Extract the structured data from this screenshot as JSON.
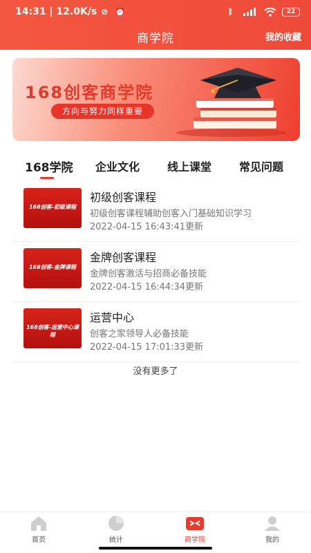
{
  "status_bar": {
    "time_speed": "14:31 | 12.0K/s",
    "battery": "22"
  },
  "header": {
    "title": "商学院",
    "favorites": "我的收藏"
  },
  "banner": {
    "title": "168创客商学院",
    "slogan": "方向与努力同样重要"
  },
  "tabs": [
    "168学院",
    "企业文化",
    "线上课堂",
    "常见问题"
  ],
  "courses": [
    {
      "name": "初级创客课程",
      "desc": "初级创客课程辅助创客入门基础知识学习",
      "time": "2022-04-15 16:43:41更新",
      "thumb_caption": "168创客-初级课程"
    },
    {
      "name": "金牌创客课程",
      "desc": "金牌创客激活与招商必备技能",
      "time": "2022-04-15 16:44:34更新",
      "thumb_caption": "168创客-金牌课程"
    },
    {
      "name": "运营中心",
      "desc": "创客之家领导人必备技能",
      "time": "2022-04-15 17:01:33更新",
      "thumb_caption": "168创客-运营中心课程"
    }
  ],
  "no_more": "没有更多了",
  "bottom_tabs": [
    "首页",
    "统计",
    "商学院",
    "我的"
  ],
  "colors": {
    "brand": "#ee4a3a",
    "active": "#e93b2d"
  }
}
